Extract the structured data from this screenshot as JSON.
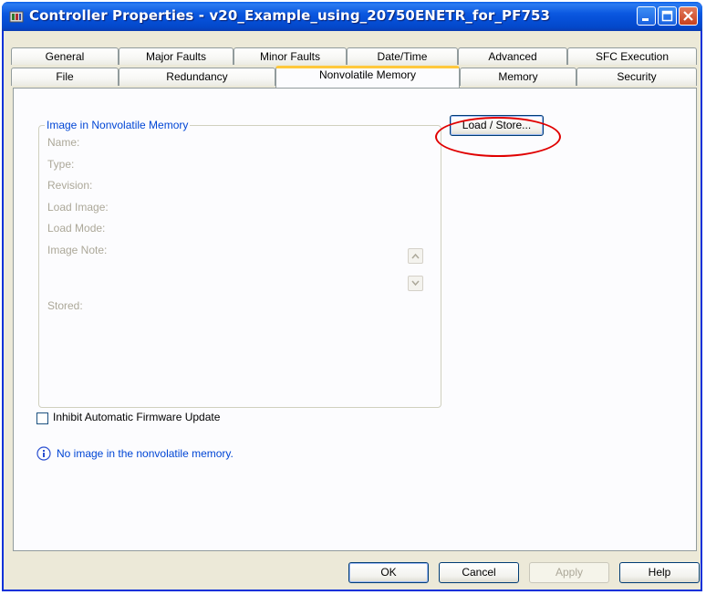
{
  "window": {
    "title": "Controller Properties - v20_Example_using_20750ENETR_for_PF753",
    "title_icon": "controller-icon",
    "controls": [
      "minimize-icon",
      "maximize-icon",
      "close-icon"
    ]
  },
  "tabs": {
    "row1": [
      "General",
      "Major Faults",
      "Minor Faults",
      "Date/Time",
      "Advanced",
      "SFC Execution"
    ],
    "row2": [
      "File",
      "Redundancy",
      "Nonvolatile Memory",
      "Memory",
      "Security"
    ],
    "active": "Nonvolatile Memory"
  },
  "groupbox": {
    "title": "Image in Nonvolatile Memory",
    "fields": [
      "Name:",
      "Type:",
      "Revision:",
      "Load Image:",
      "Load Mode:",
      "Image Note:",
      "Stored:"
    ]
  },
  "load_store_button": "Load / Store...",
  "checkbox": {
    "label": "Inhibit Automatic Firmware Update",
    "checked": false
  },
  "info_message": "No image in the nonvolatile memory.",
  "dialog_buttons": {
    "ok": "OK",
    "cancel": "Cancel",
    "apply": "Apply",
    "help": "Help"
  },
  "colors": {
    "titlebar": "#0650d8",
    "group_title": "#0046d5",
    "highlight": "#e00000",
    "active_tab_accent": "#ffc83c"
  }
}
